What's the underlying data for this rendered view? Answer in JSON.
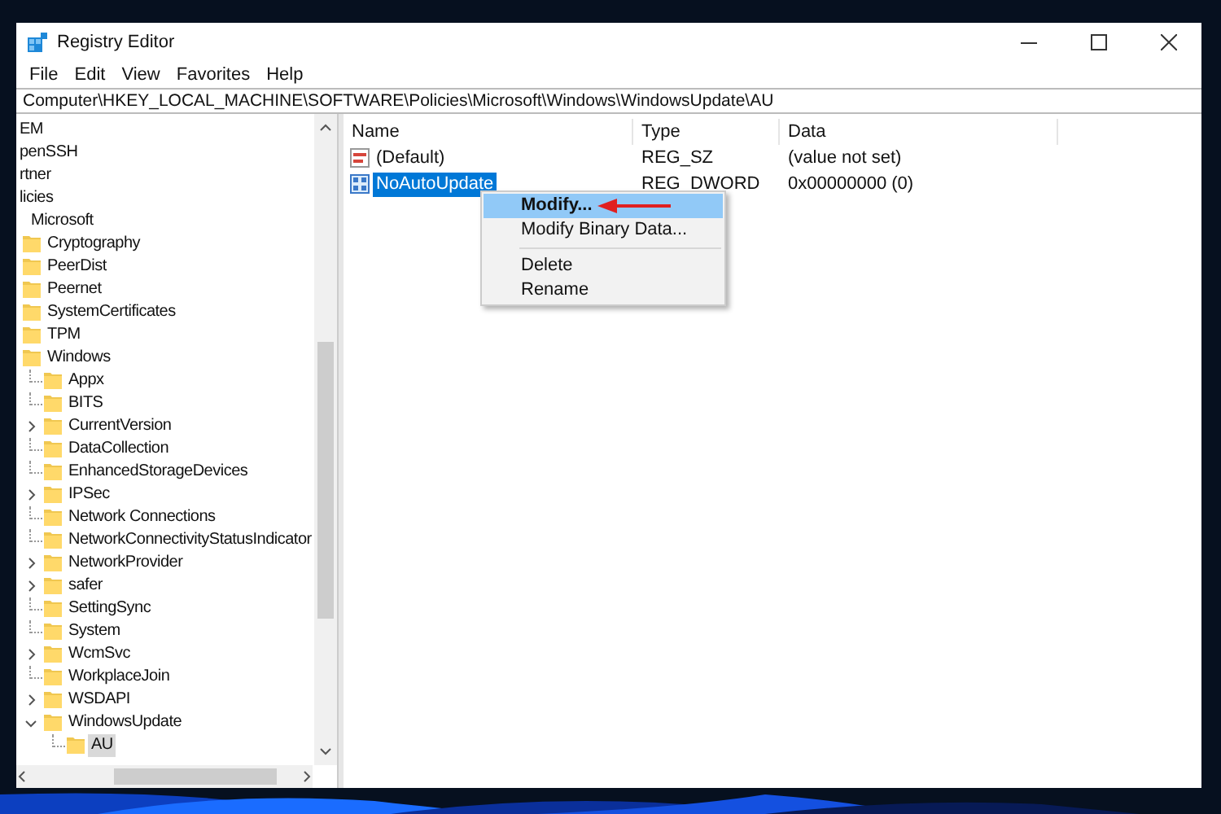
{
  "window": {
    "title": "Registry Editor"
  },
  "menu": [
    "File",
    "Edit",
    "View",
    "Favorites",
    "Help"
  ],
  "address": "Computer\\HKEY_LOCAL_MACHINE\\SOFTWARE\\Policies\\Microsoft\\Windows\\WindowsUpdate\\AU",
  "tree": [
    {
      "label": "EM",
      "selected": false
    },
    {
      "label": "penSSH",
      "selected": false
    },
    {
      "label": "rtner",
      "selected": false
    },
    {
      "label": "licies",
      "selected": false,
      "children": [
        {
          "label": "Microsoft",
          "selected": false,
          "children": [
            {
              "label": "Cryptography",
              "selected": false
            },
            {
              "label": "PeerDist",
              "selected": false
            },
            {
              "label": "Peernet",
              "selected": false
            },
            {
              "label": "SystemCertificates",
              "selected": false
            },
            {
              "label": "TPM",
              "selected": false
            },
            {
              "label": "Windows",
              "selected": false,
              "children": [
                {
                  "kind": "leaf",
                  "label": "Appx",
                  "selected": false
                },
                {
                  "kind": "leaf",
                  "label": "BITS",
                  "selected": false
                },
                {
                  "kind": "branch",
                  "label": "CurrentVersion",
                  "selected": false,
                  "expanded": false
                },
                {
                  "kind": "leaf",
                  "label": "DataCollection",
                  "selected": false
                },
                {
                  "kind": "leaf",
                  "label": "EnhancedStorageDevices",
                  "selected": false
                },
                {
                  "kind": "branch",
                  "label": "IPSec",
                  "selected": false,
                  "expanded": false
                },
                {
                  "kind": "leaf",
                  "label": "Network Connections",
                  "selected": false
                },
                {
                  "kind": "leaf",
                  "label": "NetworkConnectivityStatusIndicator",
                  "selected": false
                },
                {
                  "kind": "branch",
                  "label": "NetworkProvider",
                  "selected": false,
                  "expanded": false
                },
                {
                  "kind": "branch",
                  "label": "safer",
                  "selected": false,
                  "expanded": false
                },
                {
                  "kind": "leaf",
                  "label": "SettingSync",
                  "selected": false
                },
                {
                  "kind": "leaf",
                  "label": "System",
                  "selected": false
                },
                {
                  "kind": "branch",
                  "label": "WcmSvc",
                  "selected": false,
                  "expanded": false
                },
                {
                  "kind": "leaf",
                  "label": "WorkplaceJoin",
                  "selected": false
                },
                {
                  "kind": "branch",
                  "label": "WSDAPI",
                  "selected": false,
                  "expanded": false
                },
                {
                  "kind": "branch",
                  "label": "WindowsUpdate",
                  "selected": false,
                  "expanded": true,
                  "children": [
                    {
                      "kind": "leaf",
                      "label": "AU",
                      "selected": true
                    }
                  ]
                }
              ]
            }
          ]
        }
      ]
    }
  ],
  "values": {
    "columns": [
      "Name",
      "Type",
      "Data"
    ],
    "rows": [
      {
        "kind": "string",
        "name": "(Default)",
        "type": "REG_SZ",
        "data": "(value not set)",
        "selected": false
      },
      {
        "kind": "number",
        "name": "NoAutoUpdate",
        "type": "REG_DWORD",
        "data": "0x00000000 (0)",
        "selected": true
      }
    ]
  },
  "context_menu": {
    "items": [
      {
        "kind": "item",
        "label": "Modify...",
        "default": true,
        "highlighted": true
      },
      {
        "kind": "item",
        "label": "Modify Binary Data...",
        "default": false,
        "highlighted": false
      },
      {
        "kind": "separator"
      },
      {
        "kind": "item",
        "label": "Delete",
        "default": false,
        "highlighted": false
      },
      {
        "kind": "item",
        "label": "Rename",
        "default": false,
        "highlighted": false
      }
    ],
    "pointer_arrow": true
  }
}
